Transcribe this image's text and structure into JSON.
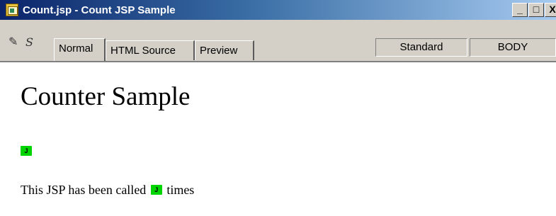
{
  "window": {
    "title": "Count.jsp - Count JSP Sample",
    "app_icon": "jsp-file-icon",
    "controls": {
      "minimize_label": "_",
      "maximize_label": "□",
      "close_label": "X"
    }
  },
  "toolbar": {
    "icons": [
      "pencil-icon",
      "s-icon"
    ],
    "pencil_glyph": "✎",
    "s_glyph": "S",
    "tabs": [
      {
        "label": "Normal",
        "active": true
      },
      {
        "label": "HTML Source",
        "active": false
      },
      {
        "label": "Preview",
        "active": false
      }
    ],
    "status": {
      "mode": "Standard",
      "element": "BODY"
    }
  },
  "document": {
    "heading": "Counter Sample",
    "marker_label": "J",
    "paragraph_before": "This JSP has been called",
    "paragraph_after": "times"
  },
  "colors": {
    "title_bar_start": "#0b246a",
    "title_bar_end": "#a6caf0",
    "chrome": "#d4d0c8",
    "jsp_marker": "#00d400"
  }
}
